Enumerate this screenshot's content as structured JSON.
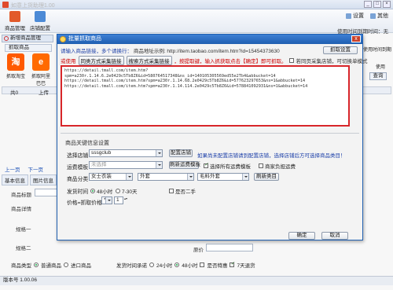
{
  "app": {
    "title": "如意上货助理1.00",
    "toolbar": {
      "goods_mgmt": "商品管理",
      "shop_config": "店铺配置",
      "settings": "设置",
      "other": "其他",
      "expire_label": "使用时间到期时间：无"
    },
    "under": {
      "tab_label": "新增商品管理",
      "fetch_btn": "抓取商品",
      "sources": [
        {
          "name": "抓取淘宝",
          "logo": "淘"
        },
        {
          "name": "抓取阿里巴巴",
          "logo": "e"
        }
      ],
      "col_no": "共0",
      "col_upload": "上传",
      "prev": "上一页",
      "next": "下一页",
      "info_tabs": [
        "基本信息",
        "图片信息"
      ],
      "labels": {
        "title": "商品标题",
        "detail": "商品详情",
        "attr1": "规格一",
        "attr2": "规格二",
        "price": "原价"
      },
      "query_btn": "查询",
      "right_texts": {
        "r1": "使用时间到期",
        "r2": "使用"
      },
      "bottom": {
        "goods_type_label": "商品类型",
        "normal": "普通商品",
        "import": "进口商品",
        "ship_time_label": "发货时间承诺",
        "h24": "24小时",
        "h48": "48小时",
        "apply": "是否特惠",
        "seven_day": "7天退货"
      },
      "status": "版本号 1.00.06"
    }
  },
  "dialog": {
    "title": "批量抓取商品",
    "close": "x",
    "hint1_blue": "请输入商品链接，多个请换行：",
    "hint1_black": "商品地址示例: http://item.taobao.com/item.htm?id=15454373630",
    "fetch_settings_btn": "抓取设置",
    "hint2_prefix": "或使用",
    "btn_sametype": "同类方式采集链接",
    "btn_search": "搜索方式采集链接",
    "hint2_note": "，按提取键，输入抓获取点击【确定】即可抓取。",
    "opt_first_page": "若同页采集店铺，可切换单模式",
    "urls": [
      "https://detail.tmall.com/item.htm?",
      "spm=a230r.1.14.6.2e0429c5Tb8Z6&id=580764517348&ns_id=140105305569ed55e2Tb4&abbucket=14",
      "https://detail.tmall.com/item.htm?spm=a230r.1.14.68.2e0429c5Tb8Z6&id=577623297653&ns=1&abbucket=14",
      "https://detail.tmall.com/item.htm?spm=a230r.1.14.114.2e0429c5Tb8Z6&id=578841092931&ns=1&abbucket=14"
    ],
    "group_title": "商品关键信息设置",
    "select_shop_label": "选择店铺",
    "shop_value": "sssgclub",
    "config_shop_btn": "配置店铺",
    "shop_note": "如果尚未配置店铺请到配置店铺，选择店铺后方可选择商品类目！",
    "freight_label": "运费模板",
    "freight_value": "未选择",
    "refresh_freight_btn": "刷新运费模板",
    "use_all_freight": "选择所有运费模板",
    "merchant_pay": "商家负担运费",
    "category_label": "商品分类",
    "cat1": "女士衣装",
    "cat2": "外套",
    "cat3": "毛料外套",
    "refresh_cat_btn": "刷新类目",
    "ship_label": "发货时间",
    "ship_48": "48小时",
    "ship_7_30": "7-30天",
    "second_hand": "是否二手",
    "price_label": "价格=抓取价格",
    "price_op": "*",
    "price_mult": "1",
    "ok_btn": "确定",
    "cancel_btn": "取消"
  },
  "colors": {
    "dialog_header": "#1f5fb0",
    "url_border": "#d8262a",
    "note_blue": "#1a3ea8",
    "taobao": "#ff5a00",
    "alibaba": "#ff6a00"
  }
}
